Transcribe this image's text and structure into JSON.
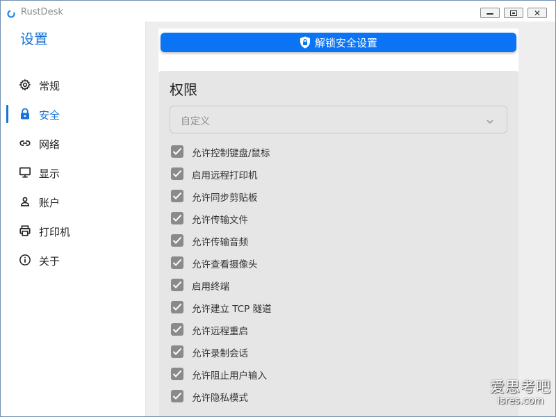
{
  "window": {
    "title": "RustDesk"
  },
  "sidebar": {
    "title": "设置",
    "items": [
      {
        "label": "常规",
        "icon": "gear-icon"
      },
      {
        "label": "安全",
        "icon": "lock-icon",
        "active": true
      },
      {
        "label": "网络",
        "icon": "link-icon"
      },
      {
        "label": "显示",
        "icon": "monitor-icon"
      },
      {
        "label": "账户",
        "icon": "user-icon"
      },
      {
        "label": "打印机",
        "icon": "printer-icon"
      },
      {
        "label": "关于",
        "icon": "info-icon"
      }
    ]
  },
  "main": {
    "unlock_button": {
      "label": "解锁安全设置",
      "icon": "shield-icon"
    },
    "permissions": {
      "title": "权限",
      "select_value": "自定义",
      "items": [
        {
          "label": "允许控制键盘/鼠标",
          "checked": true
        },
        {
          "label": "启用远程打印机",
          "checked": true
        },
        {
          "label": "允许同步剪贴板",
          "checked": true
        },
        {
          "label": "允许传输文件",
          "checked": true
        },
        {
          "label": "允许传输音频",
          "checked": true
        },
        {
          "label": "允许查看摄像头",
          "checked": true
        },
        {
          "label": "启用终端",
          "checked": true
        },
        {
          "label": "允许建立 TCP 隧道",
          "checked": true
        },
        {
          "label": "允许远程重启",
          "checked": true
        },
        {
          "label": "允许录制会话",
          "checked": true
        },
        {
          "label": "允许阻止用户输入",
          "checked": true
        },
        {
          "label": "允许隐私模式",
          "checked": true
        }
      ]
    }
  },
  "watermark": {
    "main": "爱思考吧",
    "sub": "isres.com"
  },
  "colors": {
    "accent": "#1775d6",
    "button": "#0a74f5",
    "checkbox": "#8a8a8a",
    "panel": "#e6e6e6"
  }
}
